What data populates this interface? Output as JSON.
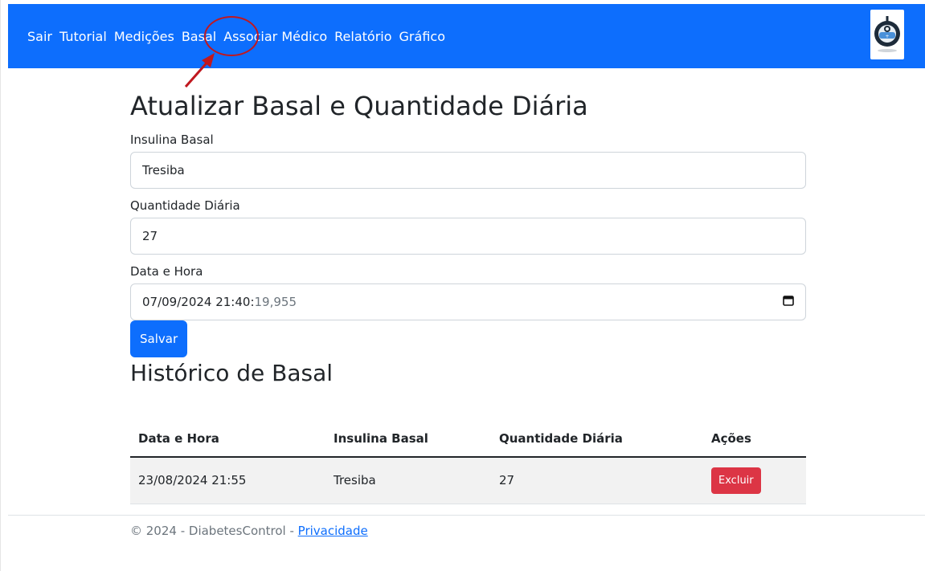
{
  "navbar": {
    "items": [
      {
        "label": "Sair"
      },
      {
        "label": "Tutorial"
      },
      {
        "label": "Medições"
      },
      {
        "label": "Basal"
      },
      {
        "label": "Associar Médico"
      },
      {
        "label": "Relatório"
      },
      {
        "label": "Gráfico"
      }
    ],
    "color": "#0d6efd",
    "logo_icon": "insulin-pen-logo-icon"
  },
  "form": {
    "title": "Atualizar Basal e Quantidade Diária",
    "basal_label": "Insulina Basal",
    "basal_value": "Tresiba",
    "quantity_label": "Quantidade Diária",
    "quantity_value": "27",
    "datetime_label": "Data e Hora",
    "datetime_value": "07/09/2024 21:40:",
    "datetime_ms": "19,955",
    "calendar_icon": "calendar-icon",
    "save_label": "Salvar"
  },
  "history": {
    "title": "Histórico de Basal",
    "columns": [
      "Data e Hora",
      "Insulina Basal",
      "Quantidade Diária",
      "Ações"
    ],
    "rows": [
      {
        "datetime": "23/08/2024 21:55",
        "basal": "Tresiba",
        "quantity": "27",
        "action_label": "Excluir"
      }
    ]
  },
  "footer": {
    "text": "© 2024 - DiabetesControl - ",
    "link_label": "Privacidade"
  },
  "annotation": {
    "color": "#c0181f"
  }
}
